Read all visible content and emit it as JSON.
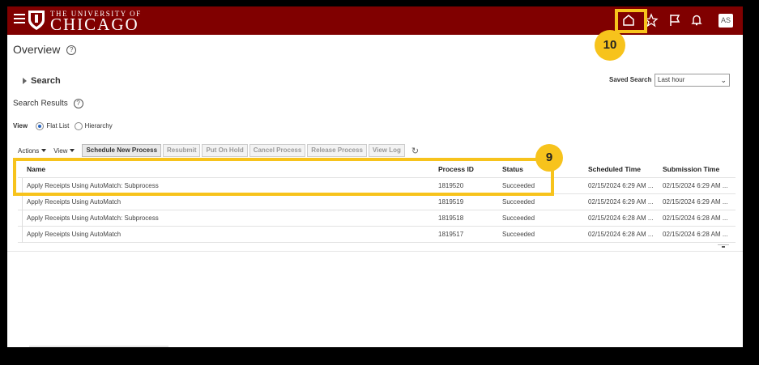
{
  "header": {
    "brand_small": "THE UNIVERSITY OF",
    "brand_big": "CHICAGO",
    "avatar_initials": "AS",
    "color": "#800000",
    "icons": [
      "hamburger-icon",
      "university-shield-logo",
      "home-icon",
      "star-icon",
      "flag-icon",
      "bell-icon"
    ]
  },
  "callouts": {
    "home": "10",
    "row": "9",
    "color": "#f7c31c"
  },
  "page": {
    "title": "Overview",
    "help_glyph": "?"
  },
  "search": {
    "toggle_label": "Search",
    "saved_search_label": "Saved Search",
    "saved_search_value": "Last hour"
  },
  "results": {
    "title": "Search Results",
    "view_label": "View",
    "view_options": [
      "Flat List",
      "Hierarchy"
    ],
    "selected_view": "Flat List"
  },
  "toolbar": {
    "actions": "Actions",
    "view": "View",
    "buttons": [
      "Schedule New Process",
      "Resubmit",
      "Put On Hold",
      "Cancel Process",
      "Release Process",
      "View Log"
    ],
    "refresh_glyph": "↻"
  },
  "table": {
    "columns": [
      "Name",
      "Process ID",
      "Status",
      "Scheduled Time",
      "Submission Time"
    ],
    "rows": [
      {
        "name": "Apply Receipts Using AutoMatch: Subprocess",
        "pid": "1819520",
        "status": "Succeeded",
        "scheduled": "02/15/2024 6:29 AM ...",
        "submission": "02/15/2024 6:29 AM ..."
      },
      {
        "name": "Apply Receipts Using AutoMatch",
        "pid": "1819519",
        "status": "Succeeded",
        "scheduled": "02/15/2024 6:29 AM ...",
        "submission": "02/15/2024 6:29 AM ..."
      },
      {
        "name": "Apply Receipts Using AutoMatch: Subprocess",
        "pid": "1819518",
        "status": "Succeeded",
        "scheduled": "02/15/2024 6:28 AM ...",
        "submission": "02/15/2024 6:28 AM ..."
      },
      {
        "name": "Apply Receipts Using AutoMatch",
        "pid": "1819517",
        "status": "Succeeded",
        "scheduled": "02/15/2024 6:28 AM ...",
        "submission": "02/15/2024 6:28 AM ..."
      }
    ]
  }
}
